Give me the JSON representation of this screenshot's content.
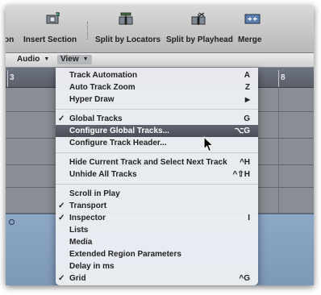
{
  "toolbar": {
    "items": [
      {
        "label": "on",
        "icon": "partial-icon"
      },
      {
        "label": "Insert Section",
        "icon": "insert-section-icon"
      },
      {
        "label": "Split by Locators",
        "icon": "split-by-locators-icon"
      },
      {
        "label": "Split by Playhead",
        "icon": "split-by-playhead-icon"
      },
      {
        "label": "Merge",
        "icon": "merge-icon"
      }
    ]
  },
  "local_menu": {
    "audio": "Audio",
    "view": "View",
    "arrow": "▼"
  },
  "ruler": {
    "left_number": "3",
    "right_number": "8"
  },
  "view_menu": {
    "items": [
      {
        "label": "Track Automation",
        "shortcut": "A",
        "check": ""
      },
      {
        "label": "Auto Track Zoom",
        "shortcut": "Z",
        "check": ""
      },
      {
        "label": "Hyper Draw",
        "shortcut": "▶",
        "check": ""
      },
      {
        "label": "Global Tracks",
        "shortcut": "G",
        "check": "✓"
      },
      {
        "label": "Configure Global Tracks...",
        "shortcut": "⌥G",
        "check": "",
        "highlighted": true
      },
      {
        "label": "Configure Track Header...",
        "shortcut": "",
        "check": ""
      },
      {
        "label": "Hide Current Track and Select Next Track",
        "shortcut": "^H",
        "check": ""
      },
      {
        "label": "Unhide All Tracks",
        "shortcut": "^⇧H",
        "check": ""
      },
      {
        "label": "Scroll in Play",
        "shortcut": "",
        "check": ""
      },
      {
        "label": "Transport",
        "shortcut": "",
        "check": "✓"
      },
      {
        "label": "Inspector",
        "shortcut": "I",
        "check": "✓"
      },
      {
        "label": "Lists",
        "shortcut": "",
        "check": ""
      },
      {
        "label": "Media",
        "shortcut": "",
        "check": ""
      },
      {
        "label": "Extended Region Parameters",
        "shortcut": "",
        "check": ""
      },
      {
        "label": "Delay in ms",
        "shortcut": "",
        "check": ""
      },
      {
        "label": "Grid",
        "shortcut": "^G",
        "check": "✓"
      }
    ]
  },
  "colors": {
    "highlight": "#4f5560",
    "region": "#8aa3c2",
    "ruler": "#646a75"
  }
}
